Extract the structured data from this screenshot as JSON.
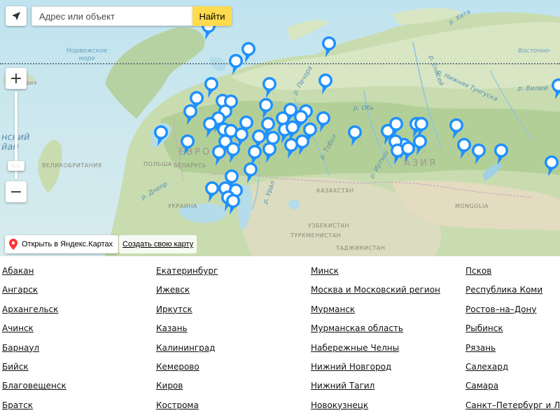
{
  "map": {
    "search": {
      "placeholder": "Адрес или объект",
      "button_label": "Найти"
    },
    "zoom": {
      "in_label": "+",
      "out_label": "−"
    },
    "open_in_yandex_label": "Открыть в Яндекс.Картах",
    "create_map_label": "Создать свою карту",
    "labels": {
      "norwegian_sea": "Норвежское\nморе",
      "europe": "ЕВРО",
      "asia": "АЗИЯ",
      "poland": "ПОЛЬША",
      "belarus": "БЕЛАРУСЬ",
      "kazakhstan": "КАЗАХСТАН",
      "turkmenistan": "ТУРКМЕНИСТАН",
      "uzbekistan": "УЗБЕКИСТАН",
      "tajikistan": "ТАДЖИКИСТАН",
      "mongolia": "MONGOLIA",
      "ukraine": "УКРАИНА",
      "great_britain": "ВЕЛИКОБРИТАНИЯ",
      "iceland": "Исландия",
      "ocean": "нский\nйан",
      "east_siberian_sea": "Восточно-",
      "yenisei": "р. Енисей",
      "ob": "р. Обь",
      "irtysh": "р. Иртыш",
      "tobol": "р. Тобол",
      "ural": "р. Урал",
      "pechora": "р. Печора",
      "lower_tunguska": "р. Нижняя Тунгуска",
      "vilyuy": "р. Вилюй",
      "khatanga": "р. Хета",
      "dnieper": "р. Днепр"
    },
    "accent_color": "#ffdb4d",
    "pin_color": "#1e90ff"
  },
  "cities": {
    "columns": [
      [
        "Абакан",
        "Ангарск",
        "Архангельск",
        "Ачинск",
        "Барнаул",
        "Бийск",
        "Благовещенск",
        "Братск"
      ],
      [
        "Екатеринбург",
        "Ижевск",
        "Иркутск",
        "Казань",
        "Калининград",
        "Кемерово",
        "Киров",
        "Кострома"
      ],
      [
        "Минск",
        "Москва и Московский регион",
        "Мурманск",
        "Мурманская область",
        "Набережные Челны",
        "Нижний Новгород",
        "Нижний Тагил",
        "Новокузнецк"
      ],
      [
        "Псков",
        "Республика Коми",
        "Ростов–на–Дону",
        "Рыбинск",
        "Рязань",
        "Салехард",
        "Самара",
        "Санкт–Петербург и ЛО"
      ]
    ]
  }
}
